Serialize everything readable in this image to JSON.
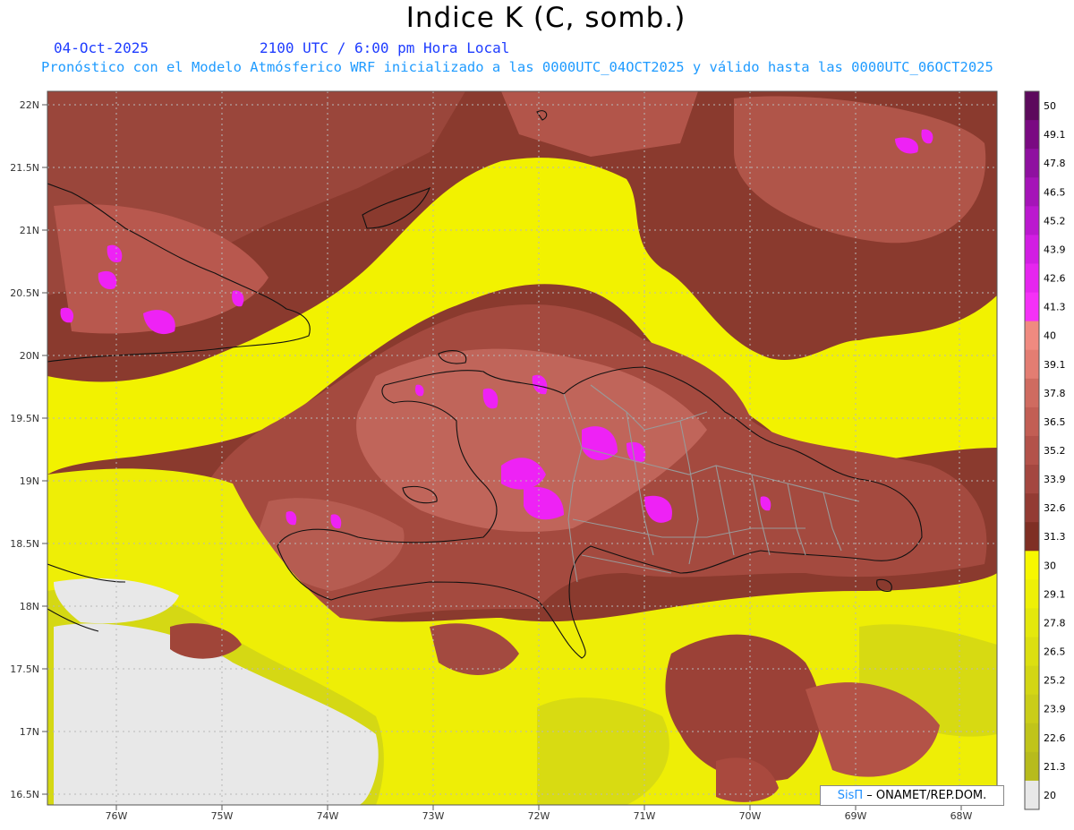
{
  "title": "Indice K (C, somb.)",
  "date": "04-Oct-2025",
  "time": "2100 UTC / 6:00 pm Hora Local",
  "subtitle": "Pronóstico con el Modelo Atmósferico WRF inicializado a las 0000UTC_04OCT2025 y válido hasta las  0000UTC_06OCT2025",
  "credit": {
    "sis": "SisΠ",
    "rest": "– ONAMET/REP.DOM."
  },
  "lat_labels": [
    "22N",
    "21.5N",
    "21N",
    "20.5N",
    "20N",
    "19.5N",
    "19N",
    "18.5N",
    "18N",
    "17.5N",
    "17N",
    "16.5N"
  ],
  "lon_labels": [
    "76W",
    "75W",
    "74W",
    "73W",
    "72W",
    "71W",
    "70W",
    "69W",
    "68W"
  ],
  "colorbar": {
    "labels": [
      "50",
      "49.1",
      "47.8",
      "46.5",
      "45.2",
      "43.9",
      "42.6",
      "41.3",
      "40",
      "39.1",
      "37.8",
      "36.5",
      "35.2",
      "33.9",
      "32.6",
      "31.3",
      "30",
      "29.1",
      "27.8",
      "26.5",
      "25.2",
      "23.9",
      "22.6",
      "21.3",
      "20"
    ],
    "colors": [
      "#5c0a5c",
      "#7a0a82",
      "#8f10a0",
      "#a514b8",
      "#bb18cf",
      "#d21ee3",
      "#e626ef",
      "#f531f7",
      "#f08a80",
      "#e37d72",
      "#cf6b60",
      "#c25e54",
      "#b3524a",
      "#a44740",
      "#933b33",
      "#7f2f24",
      "#f7f700",
      "#eef006",
      "#e4e80c",
      "#dcdf10",
      "#d3d614",
      "#cacd18",
      "#c0c41a",
      "#b7bb1c",
      "#e8e8e8"
    ]
  },
  "map_colors": {
    "deep": "#7f2f24",
    "mid": "#a44740",
    "light": "#c25e54",
    "pink": "#f0827c",
    "magenta": "#ee22f5",
    "yellow": "#f2f200",
    "olive": "#cfd41a",
    "land_gray": "#e8e8e8",
    "border": "#999999"
  }
}
